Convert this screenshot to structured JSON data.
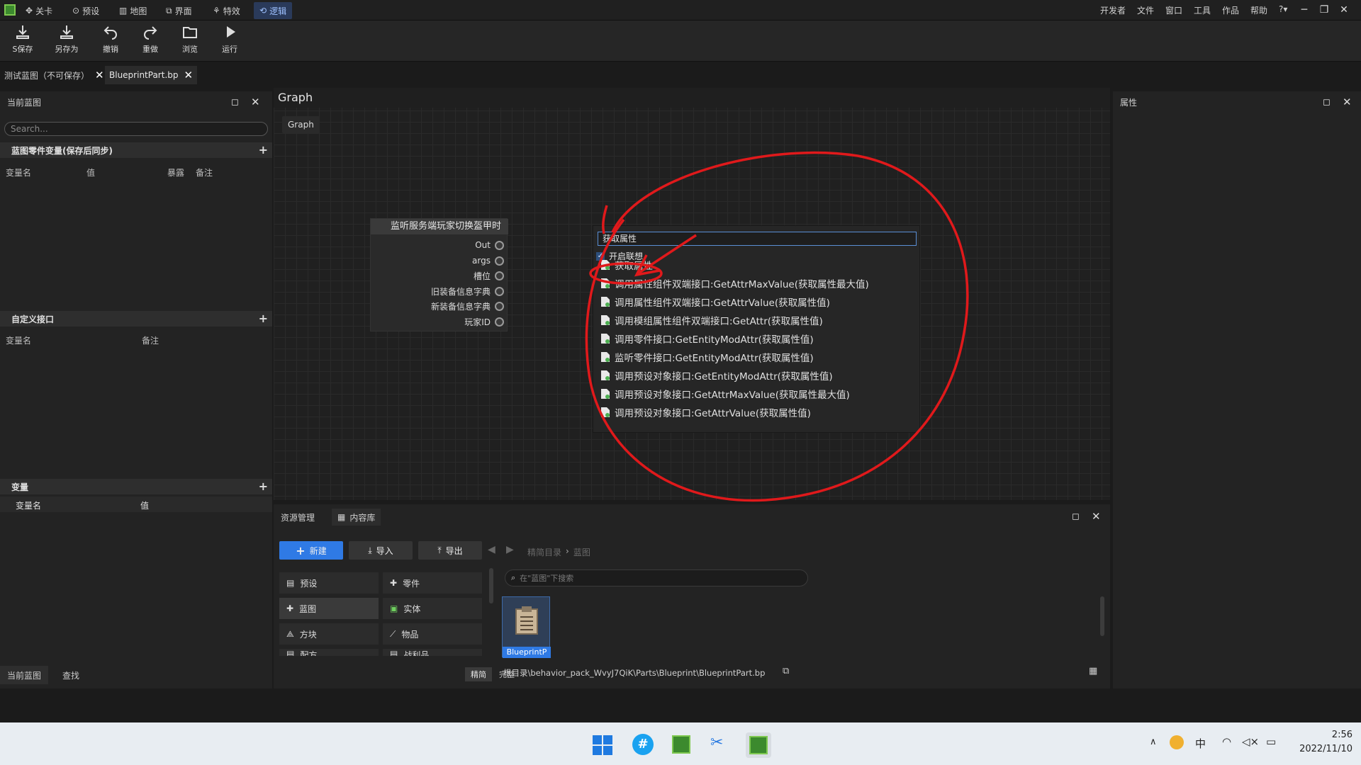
{
  "menubar": {
    "tabs": [
      {
        "label": "关卡",
        "icon": "level-icon"
      },
      {
        "label": "预设",
        "icon": "preset-icon"
      },
      {
        "label": "地图",
        "icon": "map-icon"
      },
      {
        "label": "界面",
        "icon": "ui-icon"
      },
      {
        "label": "特效",
        "icon": "effects-icon"
      },
      {
        "label": "逻辑",
        "icon": "logic-icon",
        "active": true
      }
    ],
    "right_menu": [
      "开发者",
      "文件",
      "窗口",
      "工具",
      "作品",
      "帮助",
      "?▾"
    ]
  },
  "toolbar": {
    "save": "S保存",
    "save_as": "另存为",
    "undo": "撤销",
    "redo": "重做",
    "browse": "浏览",
    "run": "运行"
  },
  "doc_tabs": [
    {
      "label": "测试蓝图（不可保存）",
      "active": false
    },
    {
      "label": "BlueprintPart.bp",
      "active": true
    }
  ],
  "left_panel": {
    "title": "当前蓝图",
    "search_placeholder": "Search...",
    "section1": {
      "title": "蓝图零件变量(保存后同步)",
      "cols": [
        "变量名",
        "值",
        "暴露",
        "备注"
      ]
    },
    "section2": {
      "title": "自定义接口",
      "cols": [
        "变量名",
        "备注"
      ]
    },
    "section3": {
      "title": "变量",
      "cols": [
        "变量名",
        "值"
      ]
    },
    "bottom_tabs": [
      "当前蓝图",
      "查找"
    ]
  },
  "graph": {
    "title": "Graph",
    "breadcrumb": "Graph",
    "node": {
      "title": "监听服务端玩家切换盔甲时",
      "pins": [
        "Out",
        "args",
        "槽位",
        "旧装备信息字典",
        "新装备信息字典",
        "玩家ID"
      ]
    },
    "popup": {
      "search_value": "获取属性",
      "context_option": "开启联想",
      "items": [
        "获取属性",
        "调用属性组件双端接口:GetAttrMaxValue(获取属性最大值)",
        "调用属性组件双端接口:GetAttrValue(获取属性值)",
        "调用模组属性组件双端接口:GetAttr(获取属性值)",
        "调用零件接口:GetEntityModAttr(获取属性值)",
        "监听零件接口:GetEntityModAttr(获取属性值)",
        "调用预设对象接口:GetEntityModAttr(获取属性值)",
        "调用预设对象接口:GetAttrMaxValue(获取属性最大值)",
        "调用预设对象接口:GetAttrValue(获取属性值)"
      ]
    }
  },
  "right_panel": {
    "title": "属性"
  },
  "bottom_panel": {
    "tabs": [
      "资源管理",
      "内容库"
    ],
    "buttons": {
      "new": "新建",
      "import": "导入",
      "export": "导出"
    },
    "breadcrumb": [
      "精简目录",
      "蓝图"
    ],
    "categories": [
      {
        "label": "预设",
        "icon": "preset-icon"
      },
      {
        "label": "零件",
        "icon": "part-icon"
      },
      {
        "label": "蓝图",
        "icon": "blueprint-icon",
        "active": true
      },
      {
        "label": "实体",
        "icon": "entity-icon"
      },
      {
        "label": "方块",
        "icon": "block-icon"
      },
      {
        "label": "物品",
        "icon": "item-icon"
      },
      {
        "label": "配方",
        "icon": "recipe-icon"
      },
      {
        "label": "战利品",
        "icon": "loot-icon"
      }
    ],
    "search_placeholder": "在\"蓝图\"下搜索",
    "asset": "BlueprintP",
    "view_modes": [
      "精简",
      "完整"
    ],
    "path": "根目录\\behavior_pack_WvyJ7QiK\\Parts\\Blueprint\\BlueprintPart.bp"
  },
  "taskbar": {
    "ime": "中",
    "time": "2:56",
    "date": "2022/11/10"
  },
  "colors": {
    "accent": "#2f7ae5",
    "annotation": "#e0191b",
    "active_tab": "#9ec1ff"
  }
}
